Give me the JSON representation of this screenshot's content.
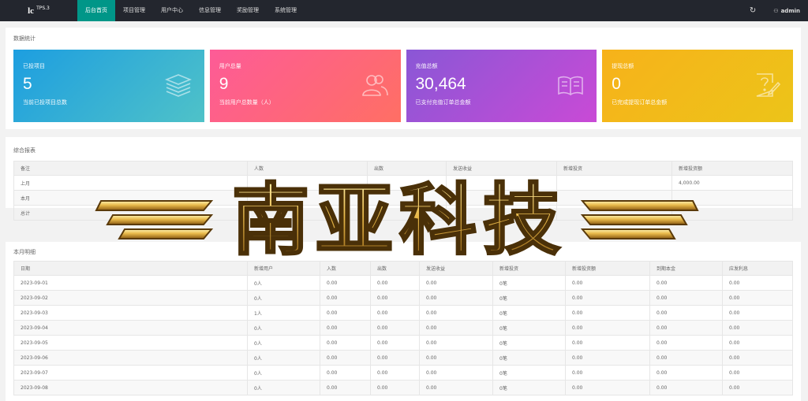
{
  "app": {
    "logo_main": "lc",
    "logo_version": "TPS.3",
    "user": "admin"
  },
  "nav": [
    {
      "label": "后台首页"
    },
    {
      "label": "项目管理"
    },
    {
      "label": "用户中心"
    },
    {
      "label": "信息管理"
    },
    {
      "label": "奖励管理"
    },
    {
      "label": "系统管理"
    }
  ],
  "stats": {
    "title": "数据统计",
    "cards": [
      {
        "label": "已投项目",
        "value": "5",
        "desc": "当前已投项目总数",
        "icon": "layers-icon"
      },
      {
        "label": "用户总量",
        "value": "9",
        "desc": "当前用户总数量（人）",
        "icon": "users-icon"
      },
      {
        "label": "充值总额",
        "value": "30,464",
        "desc": "已支付充值订单总金额",
        "icon": "book-icon"
      },
      {
        "label": "提现总额",
        "value": "0",
        "desc": "已完成提现订单总金额",
        "icon": "question-edit-icon"
      }
    ]
  },
  "report": {
    "title": "综合报表",
    "headers": [
      "备注",
      "人数",
      "出数",
      "发送收益",
      "新增投资",
      "新增投资额"
    ],
    "rows": [
      [
        "上月",
        "",
        "",
        "",
        "",
        "4,000.00"
      ],
      [
        "本月",
        "",
        "",
        "",
        "",
        ""
      ],
      [
        "总计",
        "",
        "",
        "",
        "",
        ""
      ]
    ]
  },
  "detail": {
    "title": "本月明细",
    "headers": [
      "日期",
      "新增用户",
      "入数",
      "出数",
      "发送收益",
      "新增投资",
      "新增投资额",
      "到期本金",
      "应发利息"
    ],
    "rows": [
      [
        "2023-09-01",
        "0人",
        "0.00",
        "0.00",
        "0.00",
        "0笔",
        "0.00",
        "0.00",
        "0.00"
      ],
      [
        "2023-09-02",
        "0人",
        "0.00",
        "0.00",
        "0.00",
        "0笔",
        "0.00",
        "0.00",
        "0.00"
      ],
      [
        "2023-09-03",
        "1人",
        "0.00",
        "0.00",
        "0.00",
        "0笔",
        "0.00",
        "0.00",
        "0.00"
      ],
      [
        "2023-09-04",
        "0人",
        "0.00",
        "0.00",
        "0.00",
        "0笔",
        "0.00",
        "0.00",
        "0.00"
      ],
      [
        "2023-09-05",
        "0人",
        "0.00",
        "0.00",
        "0.00",
        "0笔",
        "0.00",
        "0.00",
        "0.00"
      ],
      [
        "2023-09-06",
        "0人",
        "0.00",
        "0.00",
        "0.00",
        "0笔",
        "0.00",
        "0.00",
        "0.00"
      ],
      [
        "2023-09-07",
        "0人",
        "0.00",
        "0.00",
        "0.00",
        "0笔",
        "0.00",
        "0.00",
        "0.00"
      ],
      [
        "2023-09-08",
        "0人",
        "0.00",
        "0.00",
        "0.00",
        "0笔",
        "0.00",
        "0.00",
        "0.00"
      ]
    ]
  },
  "watermark": {
    "text": "南亚科技"
  }
}
